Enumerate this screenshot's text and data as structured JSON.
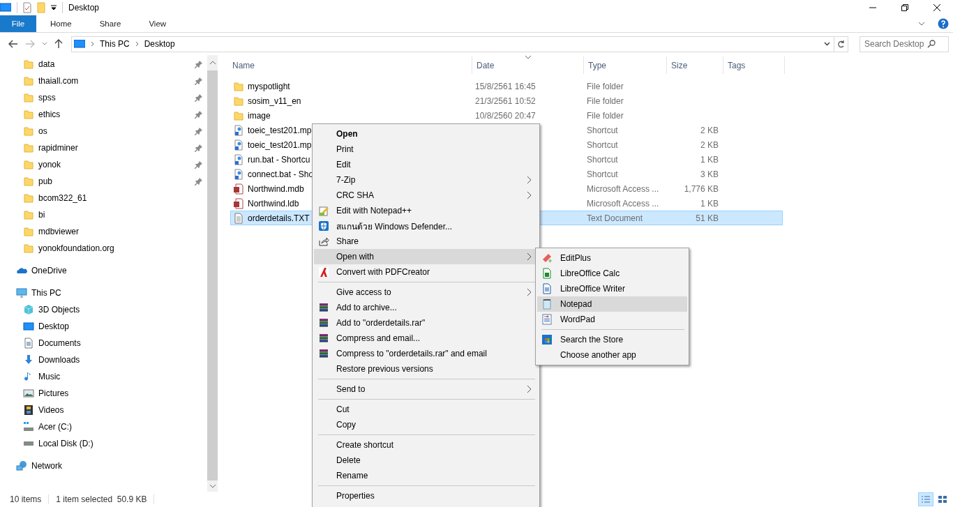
{
  "window": {
    "title": "Desktop",
    "controls": [
      {
        "kind": "minimize"
      },
      {
        "kind": "maximize"
      },
      {
        "kind": "close"
      }
    ]
  },
  "ribbon": {
    "tabs": [
      {
        "label": "File",
        "selected": true
      },
      {
        "label": "Home",
        "selected": false
      },
      {
        "label": "Share",
        "selected": false
      },
      {
        "label": "View",
        "selected": false
      }
    ]
  },
  "address": {
    "path": [
      "This PC",
      "Desktop"
    ],
    "search": {
      "placeholder": "Search Desktop"
    }
  },
  "quick_access": [
    {
      "label": "data",
      "pinned": true
    },
    {
      "label": "thaiall.com",
      "pinned": true
    },
    {
      "label": "spss",
      "pinned": true
    },
    {
      "label": "ethics",
      "pinned": true
    },
    {
      "label": "os",
      "pinned": true
    },
    {
      "label": "rapidminer",
      "pinned": true
    },
    {
      "label": "yonok",
      "pinned": true
    },
    {
      "label": "pub",
      "pinned": true
    },
    {
      "label": "bcom322_61",
      "pinned": false
    },
    {
      "label": "bi",
      "pinned": false
    },
    {
      "label": "mdbviewer",
      "pinned": false
    },
    {
      "label": "yonokfoundation.org",
      "pinned": false
    }
  ],
  "tree": [
    {
      "label": "OneDrive",
      "kind": "cloud"
    },
    {
      "label": "This PC",
      "kind": "monitor",
      "children": [
        {
          "label": "3D Objects",
          "kind": "cube"
        },
        {
          "label": "Desktop",
          "kind": "desktop"
        },
        {
          "label": "Documents",
          "kind": "document"
        },
        {
          "label": "Downloads",
          "kind": "download"
        },
        {
          "label": "Music",
          "kind": "music"
        },
        {
          "label": "Pictures",
          "kind": "picture"
        },
        {
          "label": "Videos",
          "kind": "film"
        },
        {
          "label": "Acer (C:)",
          "kind": "drive-c"
        },
        {
          "label": "Local Disk (D:)",
          "kind": "drive"
        }
      ]
    },
    {
      "label": "Network",
      "kind": "network"
    }
  ],
  "table": {
    "columns": [
      "Name",
      "Date",
      "Type",
      "Size",
      "Tags"
    ],
    "rows": [
      {
        "kind": "folder",
        "name": "myspotlight",
        "date": "15/8/2561 16:45",
        "type": "File folder",
        "selected": false
      },
      {
        "kind": "folder",
        "name": "sosim_v11_en",
        "date": "21/3/2561 10:52",
        "type": "File folder",
        "selected": false
      },
      {
        "kind": "folder",
        "name": "image",
        "date": "10/8/2560 20:47",
        "type": "File folder",
        "selected": false
      },
      {
        "kind": "shortcut",
        "name": "toeic_test201.mp",
        "type": "Shortcut",
        "size": "2 KB",
        "selected": false
      },
      {
        "kind": "shortcut",
        "name": "toeic_test201.mp",
        "type": "Shortcut",
        "size": "2 KB",
        "selected": false
      },
      {
        "kind": "shortcut",
        "name": "run.bat - Shortcu",
        "type": "Shortcut",
        "size": "1 KB",
        "selected": false
      },
      {
        "kind": "shortcut",
        "name": "connect.bat - Sho",
        "type": "Shortcut",
        "size": "3 KB",
        "selected": false
      },
      {
        "kind": "access",
        "name": "Northwind.mdb",
        "type": "Microsoft Access ...",
        "size": "1,776 KB",
        "selected": false
      },
      {
        "kind": "access",
        "name": "Northwind.ldb",
        "type": "Microsoft Access ...",
        "size": "1 KB",
        "selected": false
      },
      {
        "kind": "text",
        "name": "orderdetails.TXT",
        "type": "Text Document",
        "size": "51 KB",
        "selected": true
      }
    ]
  },
  "context_menu": [
    {
      "kind": "command",
      "label": "Open",
      "default": true,
      "selected": false
    },
    {
      "kind": "command",
      "label": "Print",
      "selected": false
    },
    {
      "kind": "command",
      "label": "Edit",
      "selected": false
    },
    {
      "kind": "command",
      "label": "7-Zip",
      "submenu": true,
      "selected": false
    },
    {
      "kind": "command",
      "label": "CRC SHA",
      "submenu": true,
      "selected": false
    },
    {
      "kind": "notepad",
      "label": "Edit with Notepad++",
      "selected": false
    },
    {
      "kind": "shield",
      "label": "สแกนด้วย Windows Defender...",
      "selected": false
    },
    {
      "kind": "share",
      "label": "Share",
      "selected": false
    },
    {
      "kind": "command",
      "label": "Open with",
      "submenu": true,
      "selected": true
    },
    {
      "kind": "pdf",
      "label": "Convert with PDFCreator",
      "selected": false
    },
    {
      "kind": "separator"
    },
    {
      "kind": "command",
      "label": "Give access to",
      "submenu": true,
      "selected": false
    },
    {
      "kind": "books",
      "label": "Add to archive...",
      "selected": false
    },
    {
      "kind": "books",
      "label": "Add to \"orderdetails.rar\"",
      "selected": false
    },
    {
      "kind": "books",
      "label": "Compress and email...",
      "selected": false
    },
    {
      "kind": "books",
      "label": "Compress to \"orderdetails.rar\" and email",
      "selected": false
    },
    {
      "kind": "command",
      "label": "Restore previous versions",
      "selected": false
    },
    {
      "kind": "separator"
    },
    {
      "kind": "command",
      "label": "Send to",
      "submenu": true,
      "selected": false
    },
    {
      "kind": "separator"
    },
    {
      "kind": "command",
      "label": "Cut",
      "selected": false
    },
    {
      "kind": "command",
      "label": "Copy",
      "selected": false
    },
    {
      "kind": "separator"
    },
    {
      "kind": "command",
      "label": "Create shortcut",
      "selected": false
    },
    {
      "kind": "command",
      "label": "Delete",
      "selected": false
    },
    {
      "kind": "command",
      "label": "Rename",
      "selected": false
    },
    {
      "kind": "separator"
    },
    {
      "kind": "command",
      "label": "Properties",
      "selected": false
    }
  ],
  "open_with_menu": [
    {
      "kind": "editplus",
      "label": "EditPlus",
      "selected": false
    },
    {
      "kind": "calc",
      "label": "LibreOffice Calc",
      "selected": false
    },
    {
      "kind": "writer",
      "label": "LibreOffice Writer",
      "selected": false
    },
    {
      "kind": "notepad-app",
      "label": "Notepad",
      "selected": true
    },
    {
      "kind": "wordpad",
      "label": "WordPad",
      "selected": false
    },
    {
      "kind": "separator"
    },
    {
      "kind": "store",
      "label": "Search the Store",
      "selected": false
    },
    {
      "kind": "command",
      "label": "Choose another app",
      "selected": false
    }
  ],
  "status_bar": {
    "count": "10 items",
    "selection": "1 item selected  50.9 KB",
    "view_modes": [
      {
        "kind": "details",
        "selected": true
      },
      {
        "kind": "tiles",
        "selected": false
      }
    ]
  }
}
